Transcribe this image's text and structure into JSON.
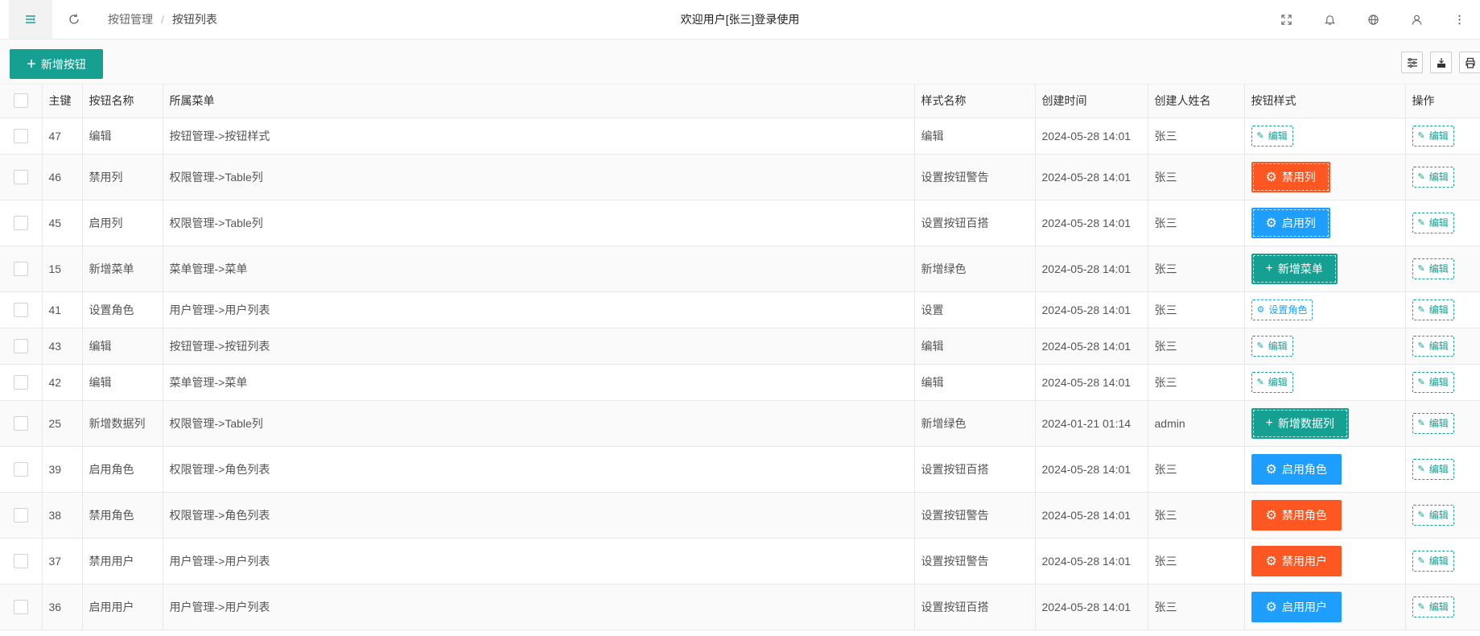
{
  "header": {
    "breadcrumb": [
      "按钮管理",
      "按钮列表"
    ],
    "breadcrumb_sep": "/",
    "welcome": "欢迎用户[张三]登录使用",
    "icons": [
      "menu-toggle-icon",
      "refresh-icon",
      "fullscreen-icon",
      "bell-icon",
      "globe-icon",
      "user-icon",
      "more-vertical-icon"
    ]
  },
  "toolbar": {
    "add_label": "新增按钮",
    "add_icon": "+",
    "right_icons": [
      "filter-columns-icon",
      "export-icon",
      "print-icon"
    ]
  },
  "colors": {
    "primary": "#16a091",
    "warning": "#ff5722",
    "info": "#1e9fff"
  },
  "table": {
    "columns": [
      "",
      "主键",
      "按钮名称",
      "所属菜单",
      "样式名称",
      "创建时间",
      "创建人姓名",
      "按钮样式",
      "操作"
    ],
    "action_label": "编辑",
    "rows": [
      {
        "id": "47",
        "name": "编辑",
        "menu": "按钮管理->按钮样式",
        "style": "编辑",
        "time": "2024-05-28 14:01",
        "creator": "张三",
        "btn": {
          "kind": "edit",
          "label": "编辑"
        }
      },
      {
        "id": "46",
        "name": "禁用列",
        "menu": "权限管理->Table列",
        "style": "设置按钮警告",
        "time": "2024-05-28 14:01",
        "creator": "张三",
        "btn": {
          "kind": "orange-dash",
          "label": "禁用列"
        }
      },
      {
        "id": "45",
        "name": "启用列",
        "menu": "权限管理->Table列",
        "style": "设置按钮百搭",
        "time": "2024-05-28 14:01",
        "creator": "张三",
        "btn": {
          "kind": "blue-dash",
          "label": "启用列"
        }
      },
      {
        "id": "15",
        "name": "新增菜单",
        "menu": "菜单管理->菜单",
        "style": "新增绿色",
        "time": "2024-05-28 14:01",
        "creator": "张三",
        "btn": {
          "kind": "green-dash",
          "label": "新增菜单"
        }
      },
      {
        "id": "41",
        "name": "设置角色",
        "menu": "用户管理->用户列表",
        "style": "设置",
        "time": "2024-05-28 14:01",
        "creator": "张三",
        "btn": {
          "kind": "set",
          "label": "设置角色"
        }
      },
      {
        "id": "43",
        "name": "编辑",
        "menu": "按钮管理->按钮列表",
        "style": "编辑",
        "time": "2024-05-28 14:01",
        "creator": "张三",
        "btn": {
          "kind": "edit",
          "label": "编辑"
        }
      },
      {
        "id": "42",
        "name": "编辑",
        "menu": "菜单管理->菜单",
        "style": "编辑",
        "time": "2024-05-28 14:01",
        "creator": "张三",
        "btn": {
          "kind": "edit",
          "label": "编辑"
        }
      },
      {
        "id": "25",
        "name": "新增数据列",
        "menu": "权限管理->Table列",
        "style": "新增绿色",
        "time": "2024-01-21 01:14",
        "creator": "admin",
        "btn": {
          "kind": "green-dash",
          "label": "新增数据列"
        }
      },
      {
        "id": "39",
        "name": "启用角色",
        "menu": "权限管理->角色列表",
        "style": "设置按钮百搭",
        "time": "2024-05-28 14:01",
        "creator": "张三",
        "btn": {
          "kind": "blue",
          "label": "启用角色"
        }
      },
      {
        "id": "38",
        "name": "禁用角色",
        "menu": "权限管理->角色列表",
        "style": "设置按钮警告",
        "time": "2024-05-28 14:01",
        "creator": "张三",
        "btn": {
          "kind": "orange",
          "label": "禁用角色"
        }
      },
      {
        "id": "37",
        "name": "禁用用户",
        "menu": "用户管理->用户列表",
        "style": "设置按钮警告",
        "time": "2024-05-28 14:01",
        "creator": "张三",
        "btn": {
          "kind": "orange",
          "label": "禁用用户"
        }
      },
      {
        "id": "36",
        "name": "启用用户",
        "menu": "用户管理->用户列表",
        "style": "设置按钮百搭",
        "time": "2024-05-28 14:01",
        "creator": "张三",
        "btn": {
          "kind": "blue",
          "label": "启用用户"
        }
      }
    ]
  }
}
